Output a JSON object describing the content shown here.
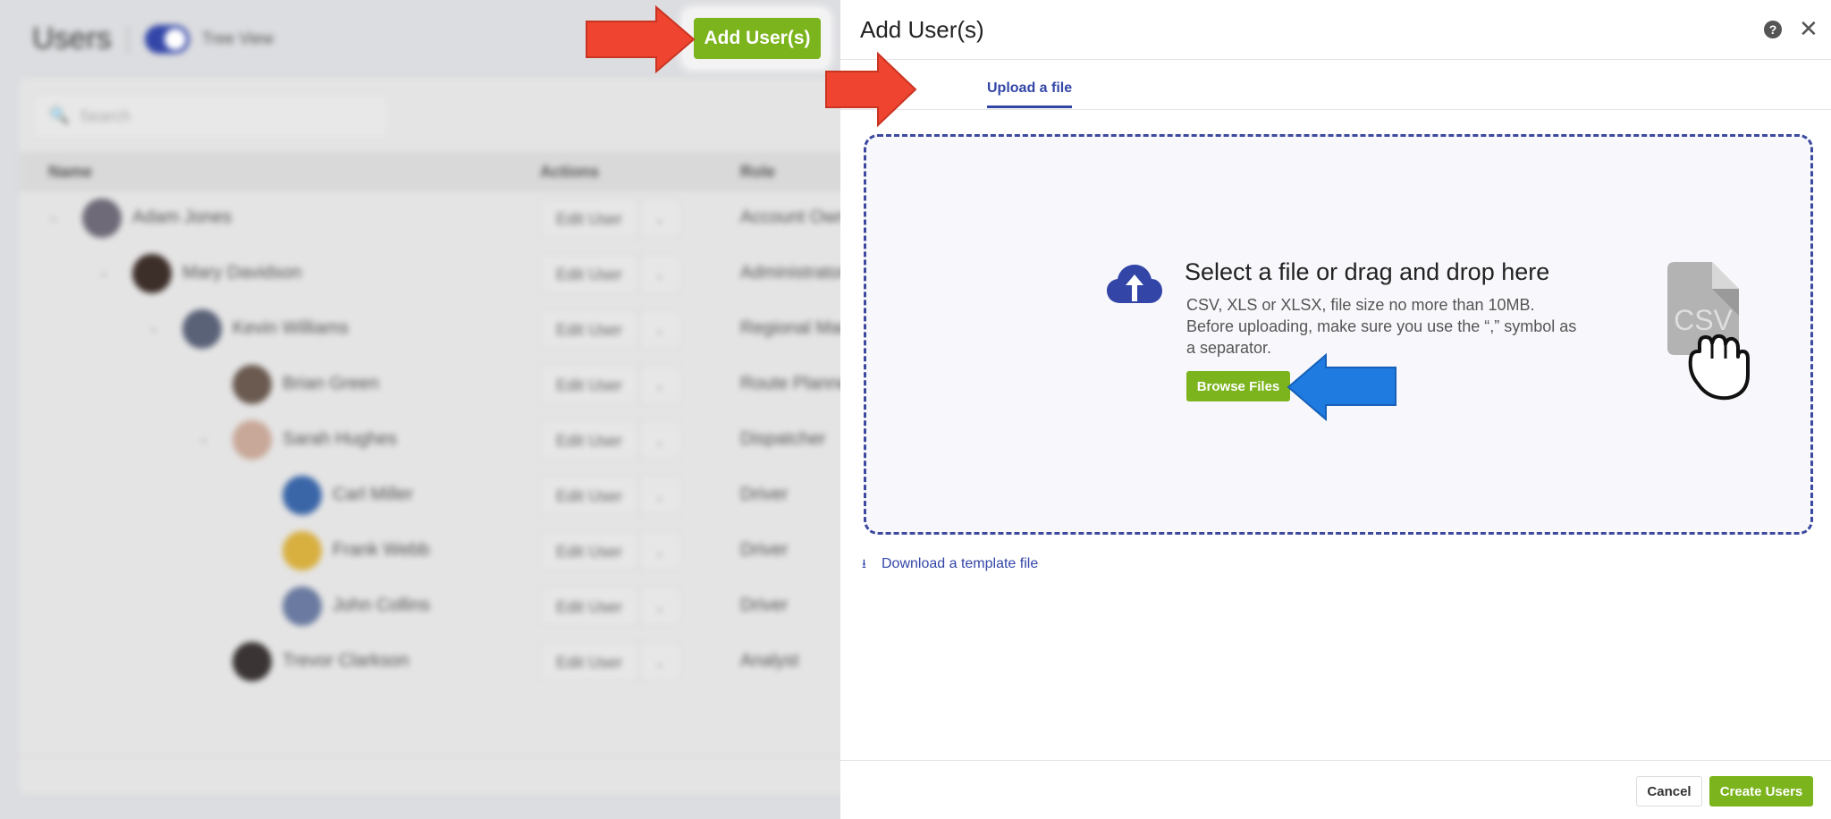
{
  "background": {
    "page_title": "Users",
    "toggle_label": "Tree View",
    "search_placeholder": "Search",
    "columns": [
      "Name",
      "Actions",
      "Role"
    ],
    "rows": [
      {
        "name": "Adam Jones",
        "action": "Edit User",
        "role": "Account Owner",
        "avatar_color": "#6e6a78",
        "level": 0,
        "expandable": true
      },
      {
        "name": "Mary Davidson",
        "action": "Edit User",
        "role": "Administrator",
        "avatar_color": "#3c2e28",
        "level": 1,
        "expandable": true
      },
      {
        "name": "Kevin Williams",
        "action": "Edit User",
        "role": "Regional Manager",
        "avatar_color": "#5a6278",
        "level": 2,
        "expandable": true
      },
      {
        "name": "Brian Green",
        "action": "Edit User",
        "role": "Route Planner",
        "avatar_color": "#6a5a50",
        "level": 3,
        "expandable": false
      },
      {
        "name": "Sarah Hughes",
        "action": "Edit User",
        "role": "Dispatcher",
        "avatar_color": "#c8a898",
        "level": 3,
        "expandable": true
      },
      {
        "name": "Carl Miller",
        "action": "Edit User",
        "role": "Driver",
        "avatar_color": "#3a66a8",
        "level": 4,
        "expandable": false
      },
      {
        "name": "Frank Webb",
        "action": "Edit User",
        "role": "Driver",
        "avatar_color": "#d8b040",
        "level": 4,
        "expandable": false
      },
      {
        "name": "John Collins",
        "action": "Edit User",
        "role": "Driver",
        "avatar_color": "#6a7aa0",
        "level": 4,
        "expandable": false
      },
      {
        "name": "Trevor Clarkson",
        "action": "Edit User",
        "role": "Analyst",
        "avatar_color": "#3a3434",
        "level": 3,
        "expandable": false
      }
    ]
  },
  "add_users_button": "Add User(s)",
  "modal": {
    "title": "Add User(s)",
    "help_icon": "?",
    "close_icon": "✕",
    "tabs": [
      {
        "label": "Upload a file",
        "active": true
      }
    ],
    "dropzone": {
      "title": "Select a file or drag and drop here",
      "description": "CSV, XLS or XLSX, file size no more than 10MB. Before uploading, make sure you use the “,” symbol as a separator.",
      "browse_button": "Browse Files",
      "file_icon_label": "CSV"
    },
    "download_link": "Download a template file",
    "footer": {
      "cancel": "Cancel",
      "create": "Create Users"
    }
  },
  "colors": {
    "accent_green": "#7cb41d",
    "accent_blue": "#3346a8",
    "annotation_red": "#ee4430",
    "annotation_blue": "#1f7be0"
  }
}
